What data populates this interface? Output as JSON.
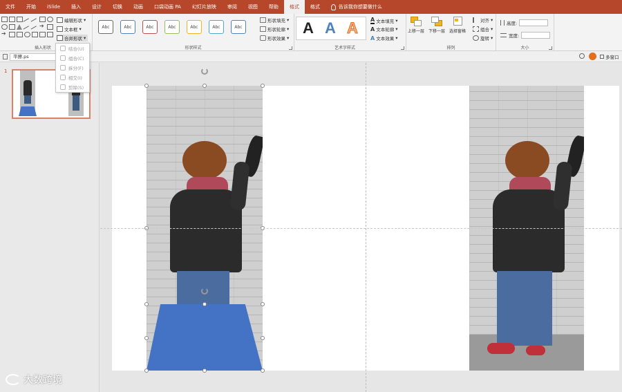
{
  "tabs": [
    "文件",
    "开始",
    "iSlide",
    "插入",
    "设计",
    "切换",
    "动画",
    "口袋动画 PA",
    "幻灯片放映",
    "审阅",
    "视图",
    "帮助",
    "格式",
    "格式"
  ],
  "active_tab_index": 12,
  "tell_me": "告诉我你想要做什么",
  "ribbon": {
    "insert_shapes": {
      "label": "插入形状",
      "edit_shape": "编辑形状",
      "text_box": "文本框",
      "merge_shapes": "合并形状"
    },
    "shape_styles": {
      "label": "形状样式",
      "sample_text": "Abc",
      "style_colors": [
        "#6a6a6a",
        "#4f81bd",
        "#c0504d",
        "#9bbb59",
        "#f0b323",
        "#4bacc6",
        "#4f81bd"
      ],
      "fill": "形状填充",
      "outline": "形状轮廓",
      "effects": "形状效果"
    },
    "wordart_styles": {
      "label": "艺术字样式",
      "letter": "A",
      "text_fill": "文本填充",
      "text_outline": "文本轮廓",
      "text_effects": "文本效果"
    },
    "arrange": {
      "label": "排列",
      "bring_forward": "上移一层",
      "send_backward": "下移一层",
      "selection_pane": "选择窗格",
      "align": "对齐",
      "group": "组合",
      "rotate": "旋转"
    },
    "size": {
      "label": "大小",
      "height": "高度:",
      "width": "宽度:"
    }
  },
  "merge_menu": [
    "结合(U)",
    "组合(C)",
    "拆分(F)",
    "相交(I)",
    "剪除(S)"
  ],
  "subbar": {
    "selector_value": "平擦.ps",
    "multi_window": "多窗口"
  },
  "thumbnail": {
    "number": "1"
  },
  "slide": {
    "trapezoid_color": "#4472c4"
  },
  "watermark": "大数跨境"
}
